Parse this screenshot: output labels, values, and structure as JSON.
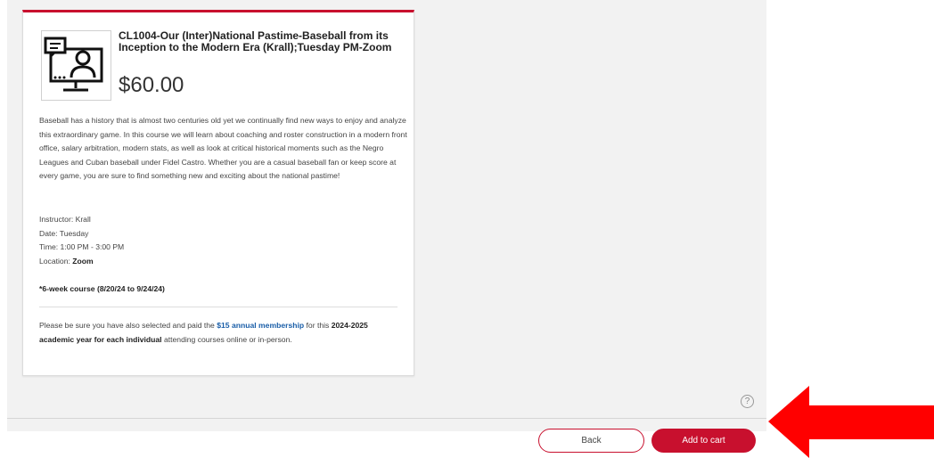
{
  "course": {
    "title": "CL1004-Our (Inter)National Pastime-Baseball from its Inception to the Modern Era (Krall);Tuesday PM-Zoom",
    "price": "$60.00",
    "description": "Baseball has a history that is almost two centuries old yet we continually find new ways to enjoy and analyze this extraordinary game. In this course we will learn about coaching and roster construction in a modern front office, salary arbitration, modern stats, as well as look at critical historical moments such as the Negro Leagues and Cuban baseball under Fidel Castro. Whether you are a casual baseball fan or keep score at every game, you are sure to find something new and exciting about the national pastime!",
    "instructor": "Instructor: Krall",
    "date": "Date: Tuesday",
    "time": "Time: 1:00 PM - 3:00 PM",
    "location_label": "Location: ",
    "location_value": "Zoom",
    "duration": "*6-week course (8/20/24 to 9/24/24)",
    "note_part1": "Please be sure you have also selected and paid the ",
    "note_link": "$15 annual membership",
    "note_part2": " for this ",
    "note_bold": "2024-2025 academic year for each individual",
    "note_part3": " attending courses online or in-person."
  },
  "thumbnail_icon": "online-class-icon",
  "help_icon_glyph": "?",
  "footer": {
    "back_label": "Back",
    "add_to_cart_label": "Add to cart"
  },
  "colors": {
    "accent": "#c8102e",
    "link": "#1a5ea8",
    "arrow": "#ff0000"
  }
}
